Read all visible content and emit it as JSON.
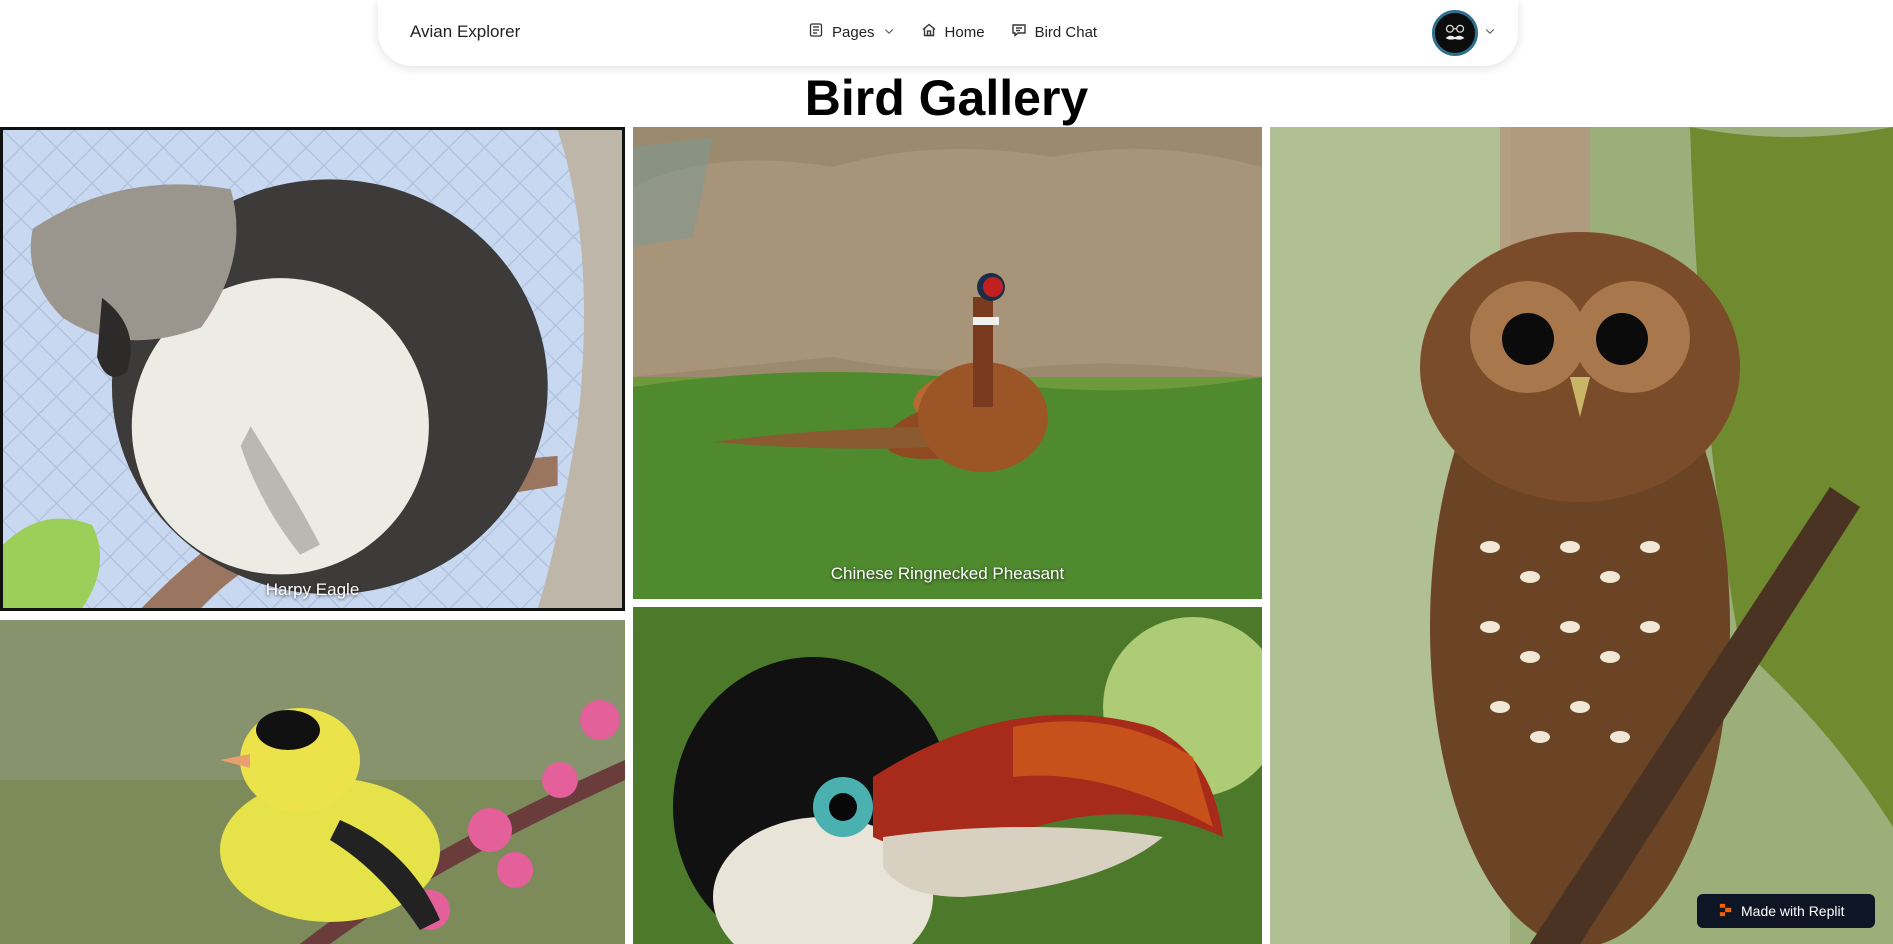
{
  "nav": {
    "brand": "Avian Explorer",
    "items": [
      {
        "label": "Pages",
        "icon": "pages-icon"
      },
      {
        "label": "Home",
        "icon": "home-icon"
      },
      {
        "label": "Bird Chat",
        "icon": "chat-icon"
      }
    ],
    "avatar_icon": "mustache-avatar-icon"
  },
  "page": {
    "title": "Bird Gallery"
  },
  "gallery": [
    {
      "caption": "Harpy Eagle"
    },
    {
      "caption": "Chinese Ringnecked Pheasant"
    },
    {
      "caption": ""
    },
    {
      "caption": ""
    },
    {
      "caption": ""
    }
  ],
  "badge": {
    "label": "Made with Replit",
    "color": "#0e1525",
    "accent": "#f26207"
  }
}
